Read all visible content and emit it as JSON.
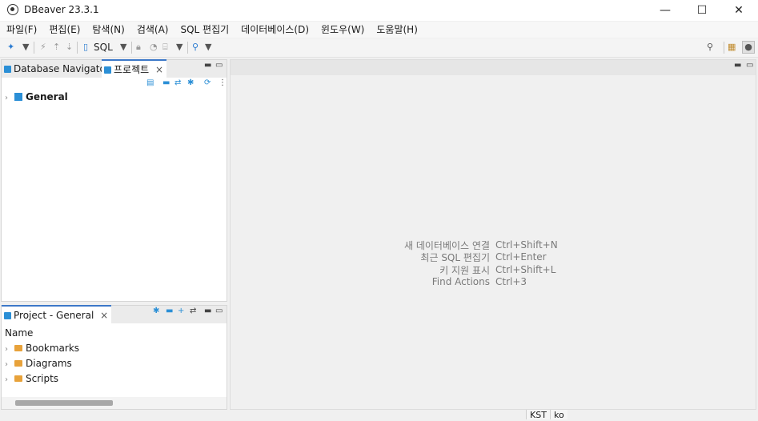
{
  "window": {
    "title": "DBeaver 23.3.1",
    "controls": {
      "minimize": "—",
      "maximize": "☐",
      "close": "✕"
    }
  },
  "menu": [
    "파일(F)",
    "편집(E)",
    "탐색(N)",
    "검색(A)",
    "SQL 편집기",
    "데이터베이스(D)",
    "윈도우(W)",
    "도움말(H)"
  ],
  "toolbar": {
    "sql_label": "SQL",
    "icons": [
      "new-connection-icon",
      "disconnect-icon",
      "commit-icon",
      "rollback-icon",
      "sql-editor-icon",
      "lock-icon",
      "transaction-log-icon",
      "schema-icon",
      "search-icon",
      "global-search-icon",
      "preferences-icon",
      "perspective-icon"
    ]
  },
  "left_top_panel": {
    "tabs": [
      {
        "label": "Database Navigator"
      },
      {
        "label": "프로젝트",
        "close": "×"
      }
    ],
    "tree": [
      {
        "label": "General",
        "bold": true
      }
    ]
  },
  "left_bottom_panel": {
    "tab": {
      "label": "Project - General",
      "close": "×"
    },
    "column_header": "Name",
    "items": [
      {
        "label": "Bookmarks"
      },
      {
        "label": "Diagrams"
      },
      {
        "label": "Scripts"
      }
    ]
  },
  "editor_area": {
    "hints": [
      {
        "label": "새 데이터베이스 연결",
        "shortcut": "Ctrl+Shift+N"
      },
      {
        "label": "최근 SQL 편집기",
        "shortcut": "Ctrl+Enter"
      },
      {
        "label": "키 지원 표시",
        "shortcut": "Ctrl+Shift+L"
      },
      {
        "label": "Find Actions",
        "shortcut": "Ctrl+3"
      }
    ]
  },
  "status": {
    "timezone": "KST",
    "locale": "ko"
  },
  "colors": {
    "accent": "#3c78c8",
    "icon_blue": "#2b8fd6",
    "folder": "#e8a23a"
  }
}
